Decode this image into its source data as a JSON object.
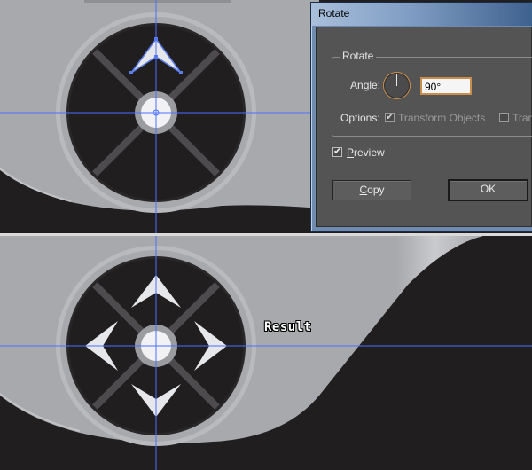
{
  "dialog": {
    "title": "Rotate",
    "group_title": "Rotate",
    "angle_label_prefix": "A",
    "angle_label_rest": "ngle:",
    "angle_value": "90°",
    "options_label": "Options:",
    "transform_objects_label": "Transform Objects",
    "transform_patterns_label": "Tran",
    "transform_objects_checked": true,
    "preview_label_prefix": "P",
    "preview_label_rest": "review",
    "preview_checked": true,
    "copy_button_prefix": "C",
    "copy_button_rest": "opy",
    "ok_button": "OK"
  },
  "canvas": {
    "result_label": "Result",
    "colors": {
      "background_dark": "#211e20",
      "panel_gray": "#a8a9ac",
      "ring_light": "#b8babe",
      "ring_dark": "#2a2729",
      "cross_lines": "#4d4b4e",
      "hub_light": "#f2f2f4",
      "hub_ring": "#9a9ca0",
      "arrow_light": "#e6e7ea",
      "guide_blue": "#4d6fff",
      "selection_blue": "#5d7de8"
    },
    "icons": [
      "arrow-up-icon",
      "arrow-down-icon",
      "arrow-left-icon",
      "arrow-right-icon"
    ]
  }
}
